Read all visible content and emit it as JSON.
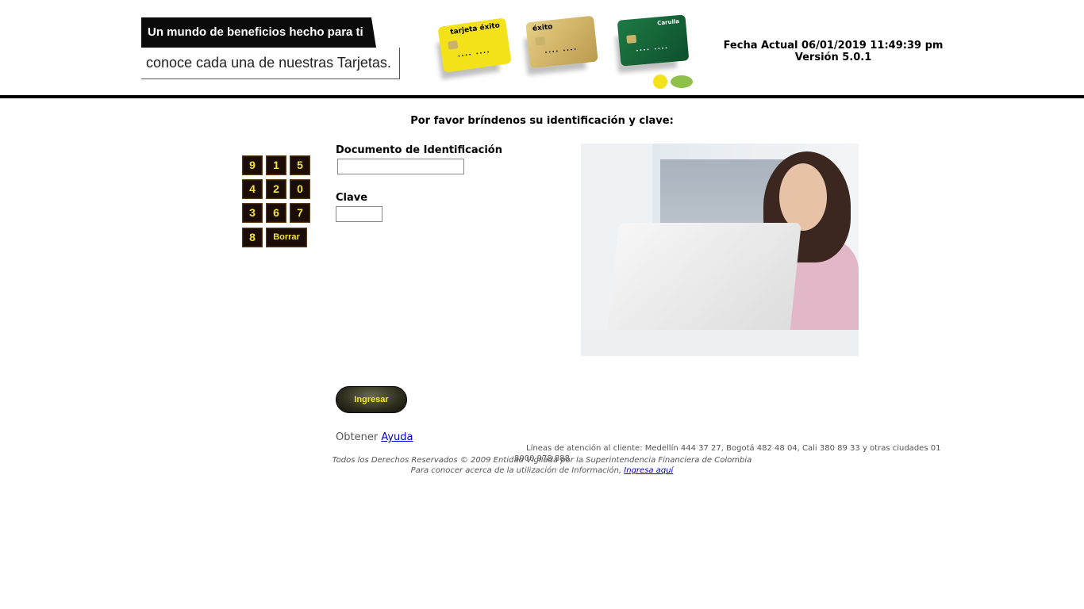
{
  "header": {
    "banner_top": "Un mundo de beneficios hecho para ti",
    "banner_bottom": "conoce cada una de nuestras Tarjetas.",
    "date_label": "Fecha Actual 06/01/2019 11:49:39 pm",
    "version_label": "Versión 5.0.1",
    "cards": [
      "tarjeta éxito",
      "éxito",
      "Carulla"
    ]
  },
  "prompt": "Por favor bríndenos su identificación y clave:",
  "keypad": {
    "keys": [
      "9",
      "1",
      "5",
      "4",
      "2",
      "0",
      "3",
      "6",
      "7",
      "8"
    ],
    "clear_label": "Borrar"
  },
  "form": {
    "doc_label": "Documento de Identificación",
    "doc_value": "",
    "clave_label": "Clave",
    "clave_value": ""
  },
  "submit_label": "Ingresar",
  "help": {
    "prefix": "Obtener",
    "link": "Ayuda"
  },
  "footer": {
    "lines": "Líneas de atención al cliente: Medellín 444 37 27, Bogotá 482 48 04, Cali 380 89 33 y otras ciudades 01 8000 978 888",
    "rights": "Todos los Derechos Reservados © 2009 Entidad Vigilada por la Superintendencia Financiera de Colombia",
    "info_prefix": "Para conocer acerca de la utilización de Información,",
    "info_link": "Ingresa aquí"
  },
  "colors": {
    "keypad_bg": "#1b0c08",
    "keypad_text": "#f2e433",
    "link": "#0000cc"
  }
}
